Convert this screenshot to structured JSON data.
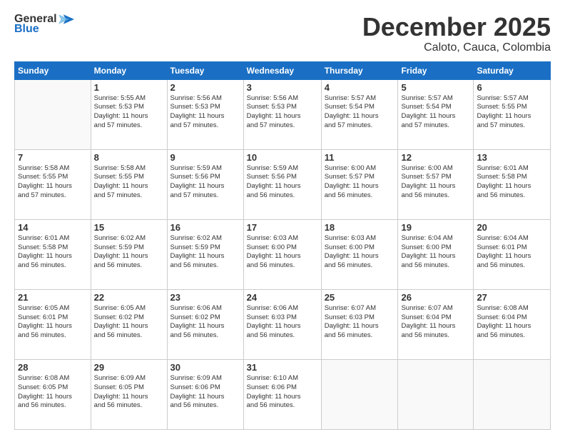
{
  "header": {
    "logo_general": "General",
    "logo_blue": "Blue",
    "month": "December 2025",
    "location": "Caloto, Cauca, Colombia"
  },
  "weekdays": [
    "Sunday",
    "Monday",
    "Tuesday",
    "Wednesday",
    "Thursday",
    "Friday",
    "Saturday"
  ],
  "weeks": [
    [
      {
        "day": "",
        "info": ""
      },
      {
        "day": "1",
        "info": "Sunrise: 5:55 AM\nSunset: 5:53 PM\nDaylight: 11 hours\nand 57 minutes."
      },
      {
        "day": "2",
        "info": "Sunrise: 5:56 AM\nSunset: 5:53 PM\nDaylight: 11 hours\nand 57 minutes."
      },
      {
        "day": "3",
        "info": "Sunrise: 5:56 AM\nSunset: 5:53 PM\nDaylight: 11 hours\nand 57 minutes."
      },
      {
        "day": "4",
        "info": "Sunrise: 5:57 AM\nSunset: 5:54 PM\nDaylight: 11 hours\nand 57 minutes."
      },
      {
        "day": "5",
        "info": "Sunrise: 5:57 AM\nSunset: 5:54 PM\nDaylight: 11 hours\nand 57 minutes."
      },
      {
        "day": "6",
        "info": "Sunrise: 5:57 AM\nSunset: 5:55 PM\nDaylight: 11 hours\nand 57 minutes."
      }
    ],
    [
      {
        "day": "7",
        "info": "Sunrise: 5:58 AM\nSunset: 5:55 PM\nDaylight: 11 hours\nand 57 minutes."
      },
      {
        "day": "8",
        "info": "Sunrise: 5:58 AM\nSunset: 5:55 PM\nDaylight: 11 hours\nand 57 minutes."
      },
      {
        "day": "9",
        "info": "Sunrise: 5:59 AM\nSunset: 5:56 PM\nDaylight: 11 hours\nand 57 minutes."
      },
      {
        "day": "10",
        "info": "Sunrise: 5:59 AM\nSunset: 5:56 PM\nDaylight: 11 hours\nand 56 minutes."
      },
      {
        "day": "11",
        "info": "Sunrise: 6:00 AM\nSunset: 5:57 PM\nDaylight: 11 hours\nand 56 minutes."
      },
      {
        "day": "12",
        "info": "Sunrise: 6:00 AM\nSunset: 5:57 PM\nDaylight: 11 hours\nand 56 minutes."
      },
      {
        "day": "13",
        "info": "Sunrise: 6:01 AM\nSunset: 5:58 PM\nDaylight: 11 hours\nand 56 minutes."
      }
    ],
    [
      {
        "day": "14",
        "info": "Sunrise: 6:01 AM\nSunset: 5:58 PM\nDaylight: 11 hours\nand 56 minutes."
      },
      {
        "day": "15",
        "info": "Sunrise: 6:02 AM\nSunset: 5:59 PM\nDaylight: 11 hours\nand 56 minutes."
      },
      {
        "day": "16",
        "info": "Sunrise: 6:02 AM\nSunset: 5:59 PM\nDaylight: 11 hours\nand 56 minutes."
      },
      {
        "day": "17",
        "info": "Sunrise: 6:03 AM\nSunset: 6:00 PM\nDaylight: 11 hours\nand 56 minutes."
      },
      {
        "day": "18",
        "info": "Sunrise: 6:03 AM\nSunset: 6:00 PM\nDaylight: 11 hours\nand 56 minutes."
      },
      {
        "day": "19",
        "info": "Sunrise: 6:04 AM\nSunset: 6:00 PM\nDaylight: 11 hours\nand 56 minutes."
      },
      {
        "day": "20",
        "info": "Sunrise: 6:04 AM\nSunset: 6:01 PM\nDaylight: 11 hours\nand 56 minutes."
      }
    ],
    [
      {
        "day": "21",
        "info": "Sunrise: 6:05 AM\nSunset: 6:01 PM\nDaylight: 11 hours\nand 56 minutes."
      },
      {
        "day": "22",
        "info": "Sunrise: 6:05 AM\nSunset: 6:02 PM\nDaylight: 11 hours\nand 56 minutes."
      },
      {
        "day": "23",
        "info": "Sunrise: 6:06 AM\nSunset: 6:02 PM\nDaylight: 11 hours\nand 56 minutes."
      },
      {
        "day": "24",
        "info": "Sunrise: 6:06 AM\nSunset: 6:03 PM\nDaylight: 11 hours\nand 56 minutes."
      },
      {
        "day": "25",
        "info": "Sunrise: 6:07 AM\nSunset: 6:03 PM\nDaylight: 11 hours\nand 56 minutes."
      },
      {
        "day": "26",
        "info": "Sunrise: 6:07 AM\nSunset: 6:04 PM\nDaylight: 11 hours\nand 56 minutes."
      },
      {
        "day": "27",
        "info": "Sunrise: 6:08 AM\nSunset: 6:04 PM\nDaylight: 11 hours\nand 56 minutes."
      }
    ],
    [
      {
        "day": "28",
        "info": "Sunrise: 6:08 AM\nSunset: 6:05 PM\nDaylight: 11 hours\nand 56 minutes."
      },
      {
        "day": "29",
        "info": "Sunrise: 6:09 AM\nSunset: 6:05 PM\nDaylight: 11 hours\nand 56 minutes."
      },
      {
        "day": "30",
        "info": "Sunrise: 6:09 AM\nSunset: 6:06 PM\nDaylight: 11 hours\nand 56 minutes."
      },
      {
        "day": "31",
        "info": "Sunrise: 6:10 AM\nSunset: 6:06 PM\nDaylight: 11 hours\nand 56 minutes."
      },
      {
        "day": "",
        "info": ""
      },
      {
        "day": "",
        "info": ""
      },
      {
        "day": "",
        "info": ""
      }
    ]
  ]
}
